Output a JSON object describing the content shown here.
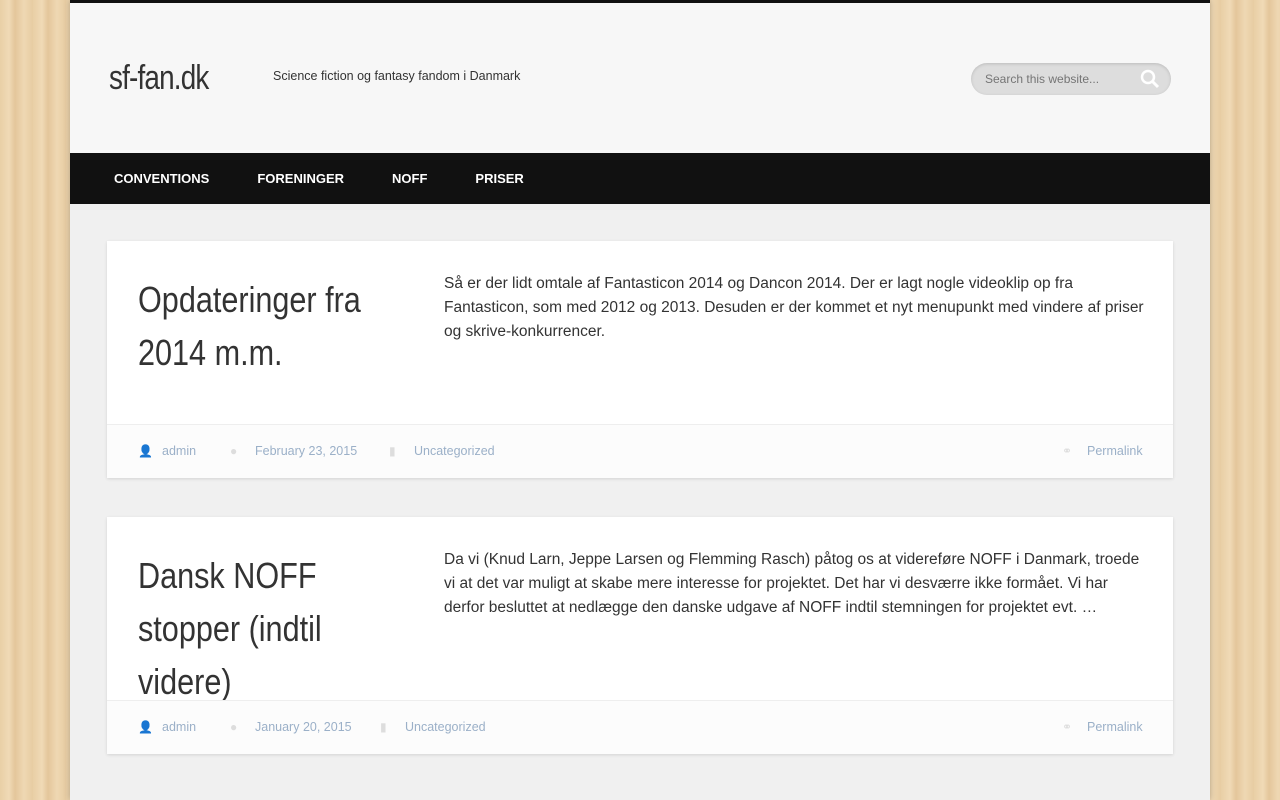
{
  "site": {
    "title": "sf-fan.dk",
    "tagline": "Science fiction og fantasy fandom i Danmark",
    "search_placeholder": "Search this website..."
  },
  "nav": [
    "CONVENTIONS",
    "FORENINGER",
    "NOFF",
    "PRISER"
  ],
  "posts": [
    {
      "title": "Opdateringer fra 2014 m.m.",
      "excerpt": "Så er der lidt omtale af Fantasticon 2014 og Dancon 2014. Der er lagt nogle videoklip op fra Fantasticon, som med 2012 og 2013. Desuden er der kommet et nyt menupunkt med vindere af priser og skrive-konkurrencer.",
      "author": "admin",
      "date": "February 23, 2015",
      "category": "Uncategorized",
      "permalink": "Permalink"
    },
    {
      "title": "Dansk NOFF stopper (indtil videre)",
      "excerpt": "Da vi (Knud Larn, Jeppe Larsen og Flemming Rasch) påtog os at videreføre NOFF i Danmark, troede vi at det var muligt at skabe mere interesse for projektet. Det har vi desværre ikke formået. Vi har derfor besluttet at nedlægge den danske udgave af NOFF indtil stemningen for projektet evt. …",
      "author": "admin",
      "date": "January 20, 2015",
      "category": "Uncategorized",
      "permalink": "Permalink"
    }
  ]
}
